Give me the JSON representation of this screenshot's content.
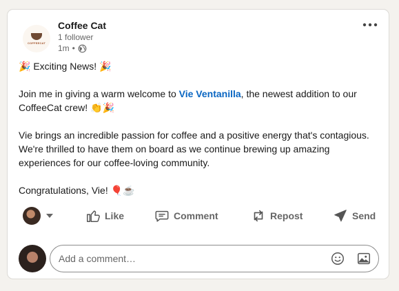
{
  "post": {
    "author": "Coffee Cat",
    "followers": "1 follower",
    "time": "1m",
    "separator": "•",
    "logo_text": "COFFEECAT",
    "line1": "🎉 Exciting News! 🎉",
    "p2_before": "Join me in giving a warm welcome to ",
    "mention": "Vie Ventanilla",
    "p2_after": ", the newest addition to our CoffeeCat crew! 👏🎉",
    "p3": "Vie brings an incredible passion for coffee and a positive energy that's contagious. We're thrilled to have them on board as we continue brewing up amazing experiences for our coffee-loving community.",
    "p4": "Congratulations, Vie! 🎈☕"
  },
  "actions": {
    "like": "Like",
    "comment": "Comment",
    "repost": "Repost",
    "send": "Send"
  },
  "comment_box": {
    "placeholder": "Add a comment…"
  },
  "colors": {
    "accent": "#0a66c2",
    "muted": "#666666"
  },
  "icons": [
    "more-icon",
    "globe-icon",
    "like-icon",
    "comment-icon",
    "repost-icon",
    "send-icon",
    "emoji-icon",
    "image-icon"
  ]
}
